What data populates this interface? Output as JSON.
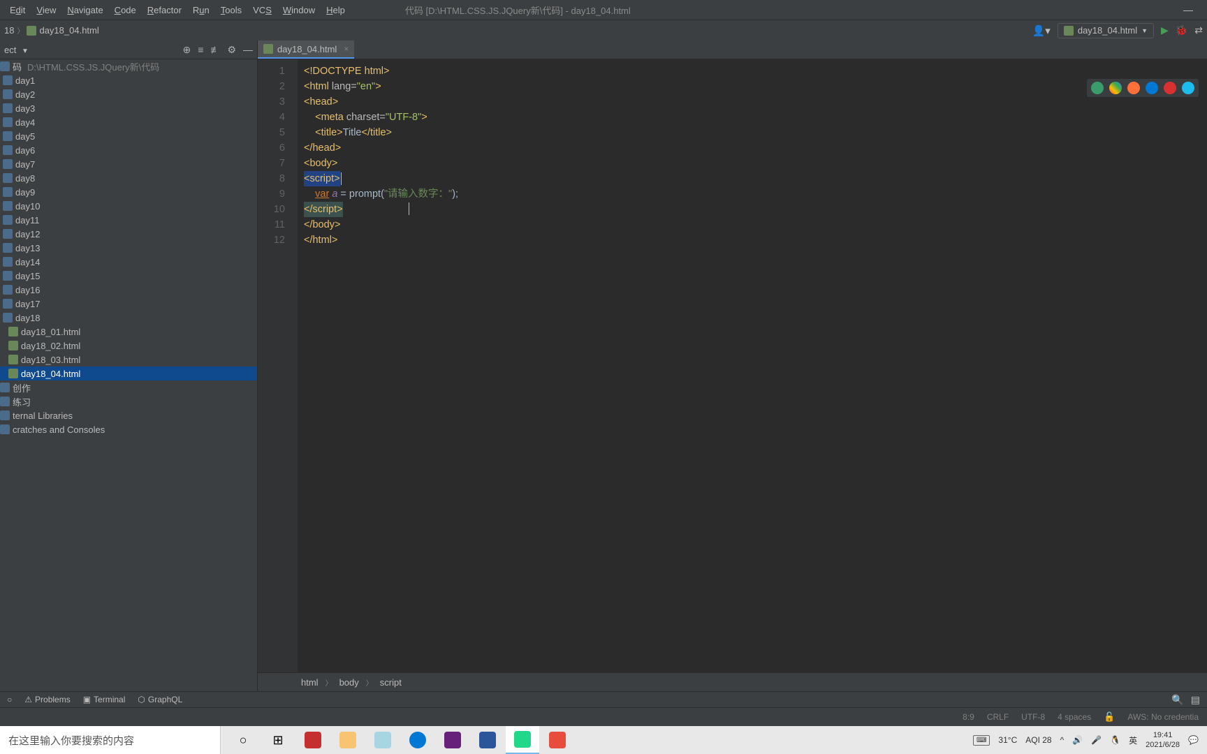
{
  "menus": [
    "Edit",
    "View",
    "Navigate",
    "Code",
    "Refactor",
    "Run",
    "Tools",
    "VCS",
    "Window",
    "Help"
  ],
  "menu_underlines": [
    "d",
    "V",
    "N",
    "C",
    "R",
    "u",
    "T",
    "S",
    "W",
    "H"
  ],
  "window_title": "代码 [D:\\HTML.CSS.JS.JQuery新\\代码] - day18_04.html",
  "nav": {
    "path_segment": "18",
    "file": "day18_04.html",
    "run_config": "day18_04.html"
  },
  "sidebar": {
    "project_label": "ect",
    "root": "码",
    "root_path": "D:\\HTML.CSS.JS.JQuery新\\代码",
    "folders": [
      "day1",
      "day2",
      "day3",
      "day4",
      "day5",
      "day6",
      "day7",
      "day8",
      "day9",
      "day10",
      "day11",
      "day12",
      "day13",
      "day14",
      "day15",
      "day16",
      "day17",
      "day18"
    ],
    "files": [
      "day18_01.html",
      "day18_02.html",
      "day18_03.html",
      "day18_04.html"
    ],
    "selected_file": "day18_04.html",
    "extras": [
      "创作",
      "练习",
      "ternal Libraries",
      "cratches and Consoles"
    ]
  },
  "editor": {
    "tab": "day18_04.html",
    "gutter": [
      "1",
      "2",
      "3",
      "4",
      "5",
      "6",
      "7",
      "8",
      "9",
      "10",
      "11",
      "12"
    ],
    "code_tokens": {
      "l1": {
        "doctype": "<!DOCTYPE ",
        "html": "html",
        "end": ">"
      },
      "l2": {
        "open": "<html ",
        "attr": "lang=",
        "val": "\"en\"",
        "close": ">"
      },
      "l3": "<head>",
      "l4": {
        "open": "    <meta ",
        "attr": "charset=",
        "val": "\"UTF-8\"",
        "close": ">"
      },
      "l5": {
        "open": "    <title>",
        "text": "Title",
        "close": "</title>"
      },
      "l6": "</head>",
      "l7": "<body>",
      "l8": "<script>",
      "l9": {
        "indent": "    ",
        "kw": "var",
        "sp1": " ",
        "var": "a",
        "eq": " = ",
        "func": "prompt",
        "paren": "(",
        "str": "\"请输入数字：\"",
        "end": ");"
      },
      "l10": "</script>",
      "l11": "</body>",
      "l12": "</html>"
    },
    "breadcrumb": [
      "html",
      "body",
      "script"
    ]
  },
  "bottom_tools": [
    "Problems",
    "Terminal",
    "GraphQL"
  ],
  "status": {
    "pos": "8:9",
    "eol": "CRLF",
    "enc": "UTF-8",
    "indent": "4 spaces",
    "aws": "AWS: No credentia"
  },
  "taskbar": {
    "search_placeholder": "在这里输入你要搜索的内容",
    "weather": "31°C",
    "aqi": "AQI 28",
    "ime": "英",
    "time": "19:41",
    "date": "2021/6/28"
  },
  "browser_colors": [
    "#3a9c6a",
    "#ea4335",
    "#ff7139",
    "#0078d4",
    "#d93030",
    "#1ebbee"
  ]
}
